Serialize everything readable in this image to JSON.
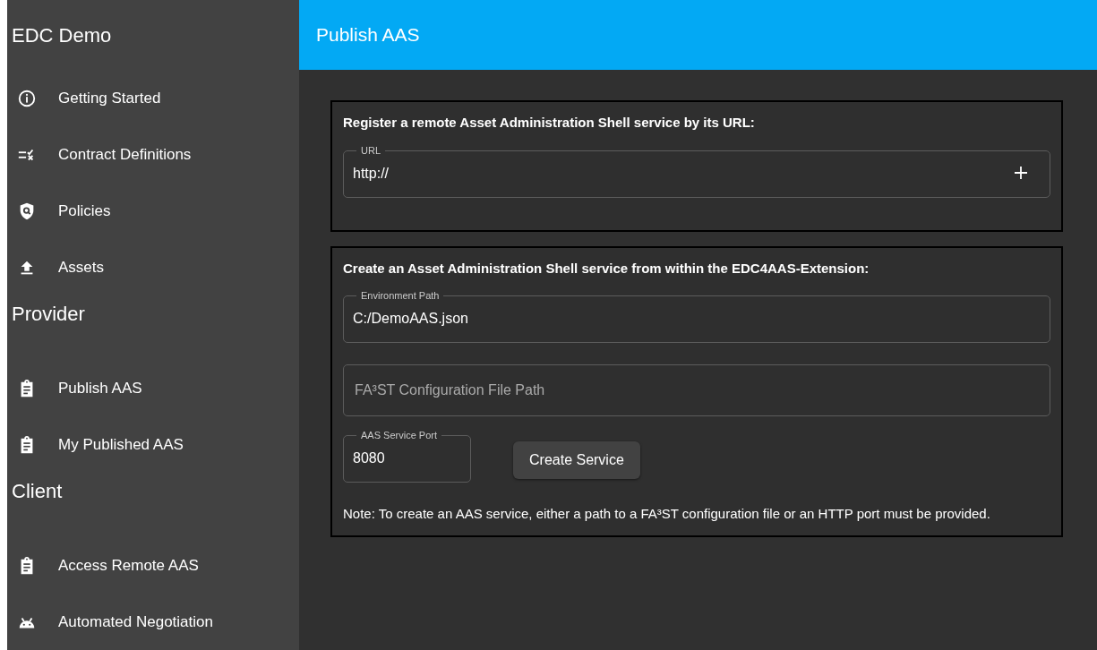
{
  "sidebar": {
    "title": "EDC Demo",
    "items": [
      {
        "kind": "link",
        "label": "Getting Started"
      },
      {
        "kind": "link",
        "label": "Contract Definitions"
      },
      {
        "kind": "link",
        "label": "Policies"
      },
      {
        "kind": "link",
        "label": "Assets"
      },
      {
        "kind": "heading",
        "label": "Provider"
      },
      {
        "kind": "link",
        "label": "Publish AAS"
      },
      {
        "kind": "link",
        "label": "My Published AAS"
      },
      {
        "kind": "heading",
        "label": "Client"
      },
      {
        "kind": "link",
        "label": "Access Remote AAS"
      },
      {
        "kind": "link",
        "label": "Automated Negotiation"
      }
    ]
  },
  "header": {
    "title": "Publish AAS"
  },
  "register_card": {
    "heading": "Register a remote Asset Administration Shell service by its URL:",
    "url_field": {
      "label": "URL",
      "value": "http://"
    }
  },
  "create_card": {
    "heading": "Create an Asset Administration Shell service from within the EDC4AAS-Extension:",
    "environment_field": {
      "label": "Environment Path",
      "value": "C:/DemoAAS.json"
    },
    "config_field": {
      "placeholder": "FA³ST Configuration File Path"
    },
    "port_field": {
      "label": "AAS Service Port",
      "value": "8080"
    },
    "button": "Create Service",
    "note": "Note: To create an AAS service, either a path to a FA³ST configuration file or an HTTP port must be provided."
  }
}
